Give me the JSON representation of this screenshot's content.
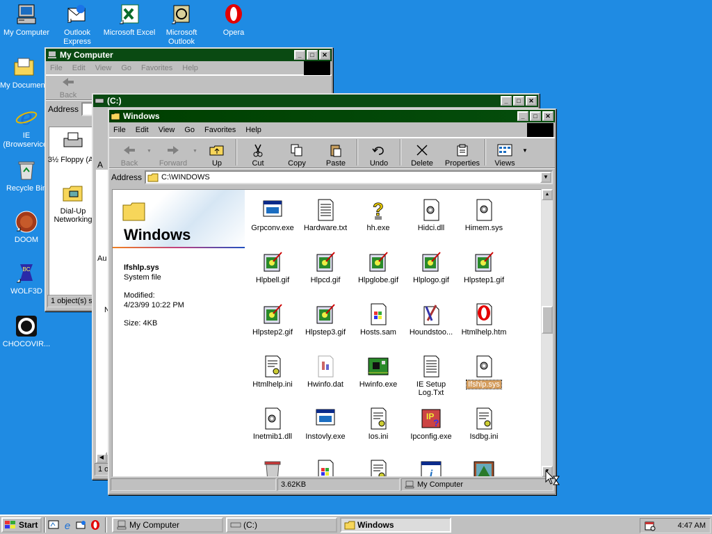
{
  "desktop": {
    "icons": [
      {
        "label": "My Computer",
        "icon": "my-computer-icon"
      },
      {
        "label": "Outlook Express",
        "icon": "outlook-express-icon"
      },
      {
        "label": "Microsoft Excel",
        "icon": "excel-icon"
      },
      {
        "label": "Microsoft Outlook",
        "icon": "outlook-icon"
      },
      {
        "label": "Opera",
        "icon": "opera-icon"
      },
      {
        "label": "My Documents",
        "icon": "my-documents-icon"
      },
      {
        "label": "IE (Browservice)",
        "icon": "ie-icon"
      },
      {
        "label": "Recycle Bin",
        "icon": "recycle-bin-icon"
      },
      {
        "label": "DOOM",
        "icon": "doom-icon"
      },
      {
        "label": "WOLF3D",
        "icon": "wolf3d-icon"
      },
      {
        "label": "CHOCOVIR...",
        "icon": "chocovir-icon"
      }
    ]
  },
  "win_mycomputer": {
    "title": "My Computer",
    "menu": [
      "File",
      "Edit",
      "View",
      "Go",
      "Favorites",
      "Help"
    ],
    "back": "Back",
    "address": "Address",
    "items": [
      "3½ Floppy (A:)",
      "Dial-Up Networking"
    ],
    "partial_side": [
      "Au",
      "N"
    ],
    "status": "1 object(s) se"
  },
  "win_c": {
    "title": "(C:)",
    "partial_a": "A",
    "status": "1 ol"
  },
  "win_windows": {
    "title": "Windows",
    "menu": [
      "File",
      "Edit",
      "View",
      "Go",
      "Favorites",
      "Help"
    ],
    "toolbar": {
      "back": "Back",
      "forward": "Forward",
      "up": "Up",
      "cut": "Cut",
      "copy": "Copy",
      "paste": "Paste",
      "undo": "Undo",
      "delete": "Delete",
      "properties": "Properties",
      "views": "Views"
    },
    "address_label": "Address",
    "address_value": "C:\\WINDOWS",
    "side": {
      "folder_title": "Windows",
      "file_name": "Ifshlp.sys",
      "file_type": "System file",
      "modified_label": "Modified:",
      "modified_value": "4/23/99 10:22 PM",
      "size": "Size: 4KB"
    },
    "files": [
      {
        "name": "Grpconv.exe",
        "icon": "exe-window-icon"
      },
      {
        "name": "Hardware.txt",
        "icon": "text-file-icon"
      },
      {
        "name": "hh.exe",
        "icon": "help-question-icon"
      },
      {
        "name": "Hidci.dll",
        "icon": "dll-gear-icon"
      },
      {
        "name": "Himem.sys",
        "icon": "sys-gear-icon"
      },
      {
        "name": "Hlpbell.gif",
        "icon": "gif-image-icon"
      },
      {
        "name": "Hlpcd.gif",
        "icon": "gif-image-icon"
      },
      {
        "name": "Hlpglobe.gif",
        "icon": "gif-image-icon"
      },
      {
        "name": "Hlplogo.gif",
        "icon": "gif-image-icon"
      },
      {
        "name": "Hlpstep1.gif",
        "icon": "gif-image-icon"
      },
      {
        "name": "Hlpstep2.gif",
        "icon": "gif-image-icon"
      },
      {
        "name": "Hlpstep3.gif",
        "icon": "gif-image-icon"
      },
      {
        "name": "Hosts.sam",
        "icon": "windows-file-icon"
      },
      {
        "name": "Houndstoo...",
        "icon": "paintbrush-file-icon"
      },
      {
        "name": "Htmlhelp.htm",
        "icon": "opera-document-icon"
      },
      {
        "name": "Htmlhelp.ini",
        "icon": "ini-file-icon"
      },
      {
        "name": "Hwinfo.dat",
        "icon": "dat-file-icon"
      },
      {
        "name": "Hwinfo.exe",
        "icon": "circuit-board-icon"
      },
      {
        "name": "IE Setup Log.Txt",
        "icon": "text-file-icon"
      },
      {
        "name": "Ifshlp.sys",
        "icon": "sys-gear-icon",
        "selected": true
      },
      {
        "name": "Inetmib1.dll",
        "icon": "dll-gear-icon"
      },
      {
        "name": "Instovly.exe",
        "icon": "exe-window-icon"
      },
      {
        "name": "Ios.ini",
        "icon": "ini-file-icon"
      },
      {
        "name": "Ipconfig.exe",
        "icon": "ipconfig-icon"
      },
      {
        "name": "Isdbg.ini",
        "icon": "ini-file-icon"
      },
      {
        "name": "",
        "icon": "trash-file-icon"
      },
      {
        "name": "",
        "icon": "windows-file-icon"
      },
      {
        "name": "",
        "icon": "ini-file-icon"
      },
      {
        "name": "",
        "icon": "info-window-icon"
      },
      {
        "name": "",
        "icon": "picture-file-icon"
      }
    ],
    "status_size": "3.62KB",
    "status_zone": "My Computer"
  },
  "taskbar": {
    "start": "Start",
    "tasks": [
      {
        "label": "My Computer",
        "icon": "my-computer-icon"
      },
      {
        "label": "(C:)",
        "icon": "drive-icon"
      },
      {
        "label": "Windows",
        "icon": "folder-icon"
      }
    ],
    "clock": "4:47 AM"
  }
}
